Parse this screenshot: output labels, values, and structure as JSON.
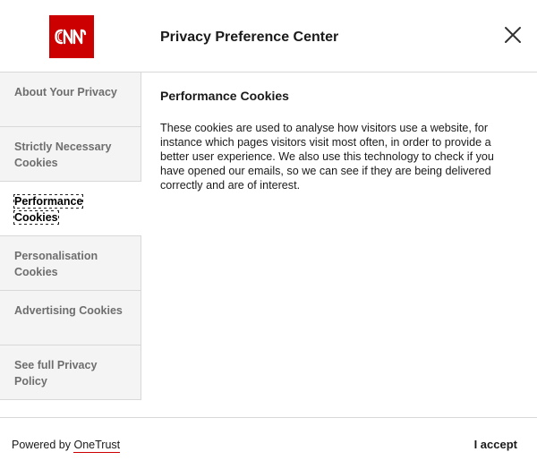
{
  "header": {
    "logo_text": "CNN",
    "title": "Privacy Preference Center",
    "close_icon": "close-icon"
  },
  "sidebar": {
    "items": [
      {
        "label": "About Your Privacy"
      },
      {
        "label": "Strictly Necessary Cookies"
      },
      {
        "label": "Performance Cookies",
        "active": true
      },
      {
        "label": "Personalisation Cookies"
      },
      {
        "label": "Advertising Cookies"
      },
      {
        "label": "See full Privacy Policy"
      }
    ]
  },
  "main": {
    "heading": "Performance Cookies",
    "body": "These cookies are used to analyse how visitors use a website, for instance which pages visitors visit most often, in order to provide a better user experience. We also use this technology to check if you have opened our emails, so we can see if they are being delivered correctly and are of interest."
  },
  "footer": {
    "powered_prefix": "Powered by ",
    "powered_link": "OneTrust",
    "accept_label": "I accept"
  },
  "colors": {
    "brand": "#cc0000",
    "sidebar_bg": "#f4f4f4",
    "divider": "#d8d8d8"
  }
}
